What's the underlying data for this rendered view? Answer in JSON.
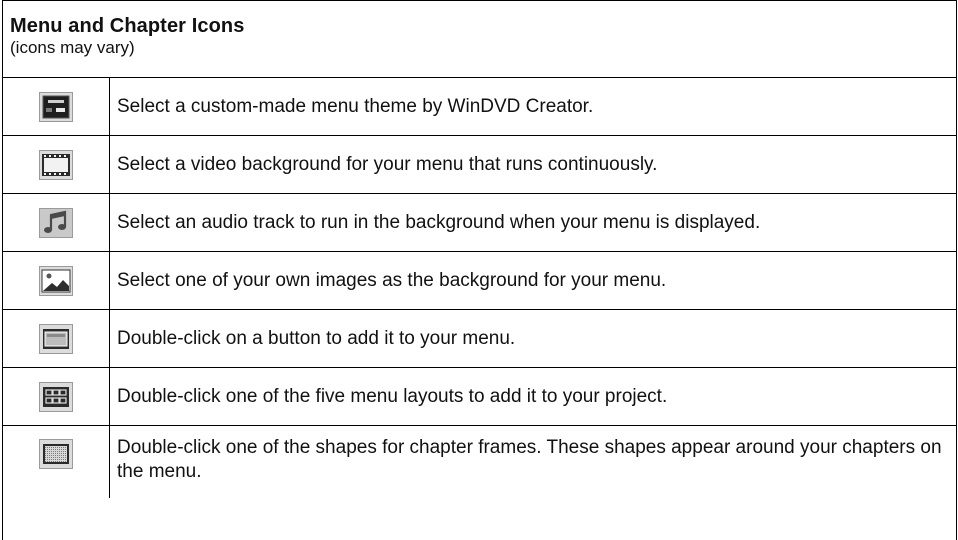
{
  "header": {
    "title": "Menu and Chapter Icons",
    "subtitle": "(icons may vary)"
  },
  "rows": [
    {
      "icon": "menu-theme-icon",
      "text": "Select a custom-made menu theme by WinDVD Creator."
    },
    {
      "icon": "video-background-icon",
      "text": "Select a video background for your menu that runs continuously."
    },
    {
      "icon": "audio-track-icon",
      "text": "Select an audio track to run in the background when your menu is displayed."
    },
    {
      "icon": "image-background-icon",
      "text": "Select one of your own images as the background for your menu."
    },
    {
      "icon": "button-icon",
      "text": "Double-click on a button to add it to your menu."
    },
    {
      "icon": "menu-layout-icon",
      "text": "Double-click one of the five menu layouts to add it to your project."
    },
    {
      "icon": "chapter-frame-icon",
      "text": "Double-click one of the shapes for chapter frames. These shapes appear around your chapters on the menu."
    }
  ]
}
